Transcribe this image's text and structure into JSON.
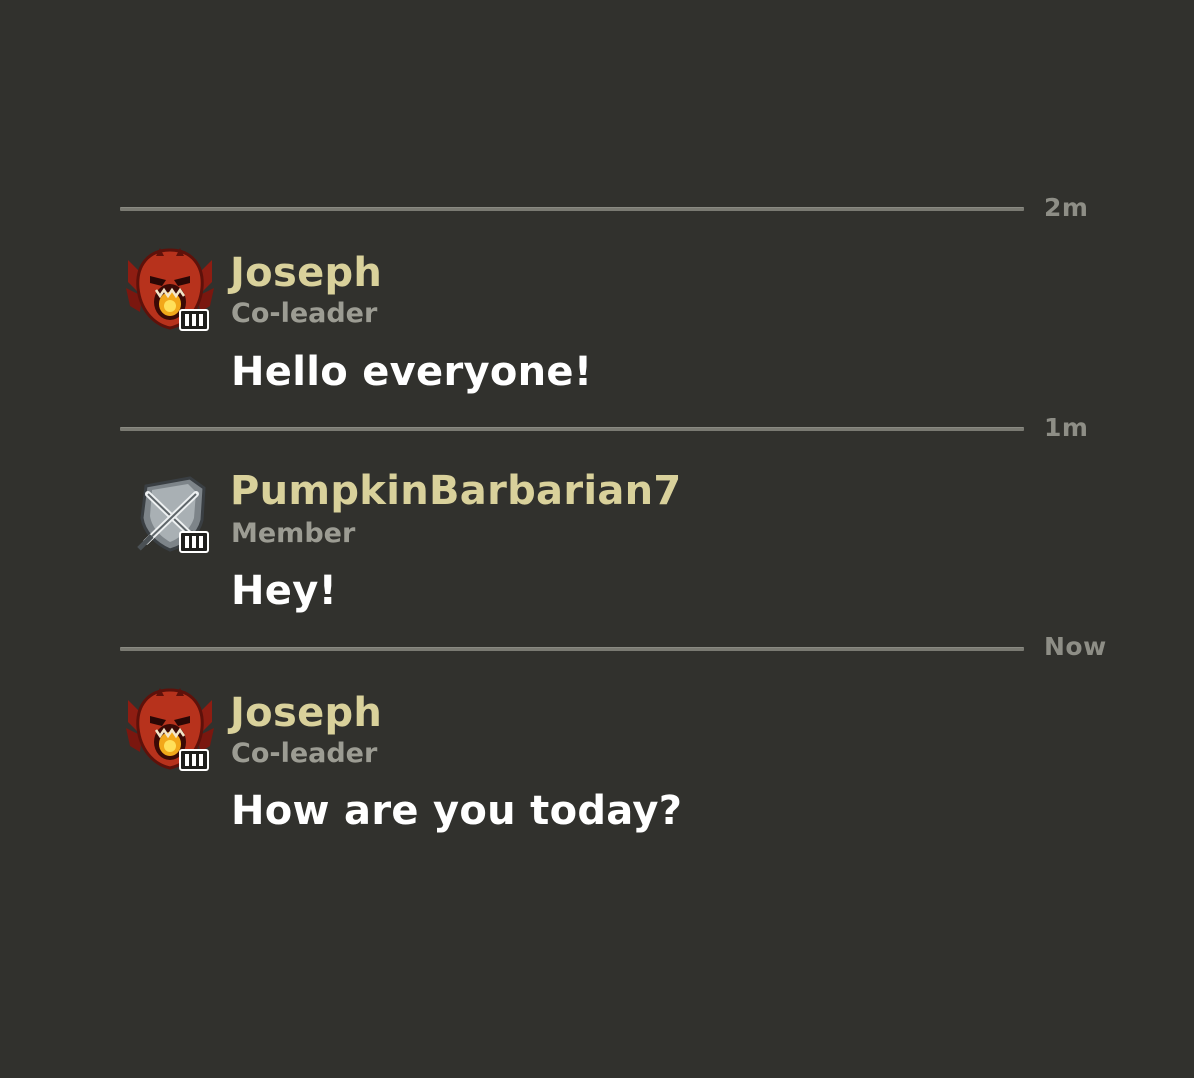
{
  "colors": {
    "background": "#31312d",
    "name": "#d9d19b",
    "role": "#9c9c93",
    "message": "#ffffff",
    "divider": "#7a7a72",
    "timestamp": "#8e8e86"
  },
  "messages": [
    {
      "timestamp": "2m",
      "name": "Joseph",
      "role": "Co-leader",
      "text": "Hello everyone!",
      "badge_icon": "demon-skull-league-badge-icon",
      "rank": "III"
    },
    {
      "timestamp": "1m",
      "name": "PumpkinBarbarian7",
      "role": "Member",
      "text": "Hey!",
      "badge_icon": "silver-crossed-swords-shield-badge-icon",
      "rank": "III"
    },
    {
      "timestamp": "Now",
      "name": "Joseph",
      "role": "Co-leader",
      "text": "How are you today?",
      "badge_icon": "demon-skull-league-badge-icon",
      "rank": "III"
    }
  ]
}
